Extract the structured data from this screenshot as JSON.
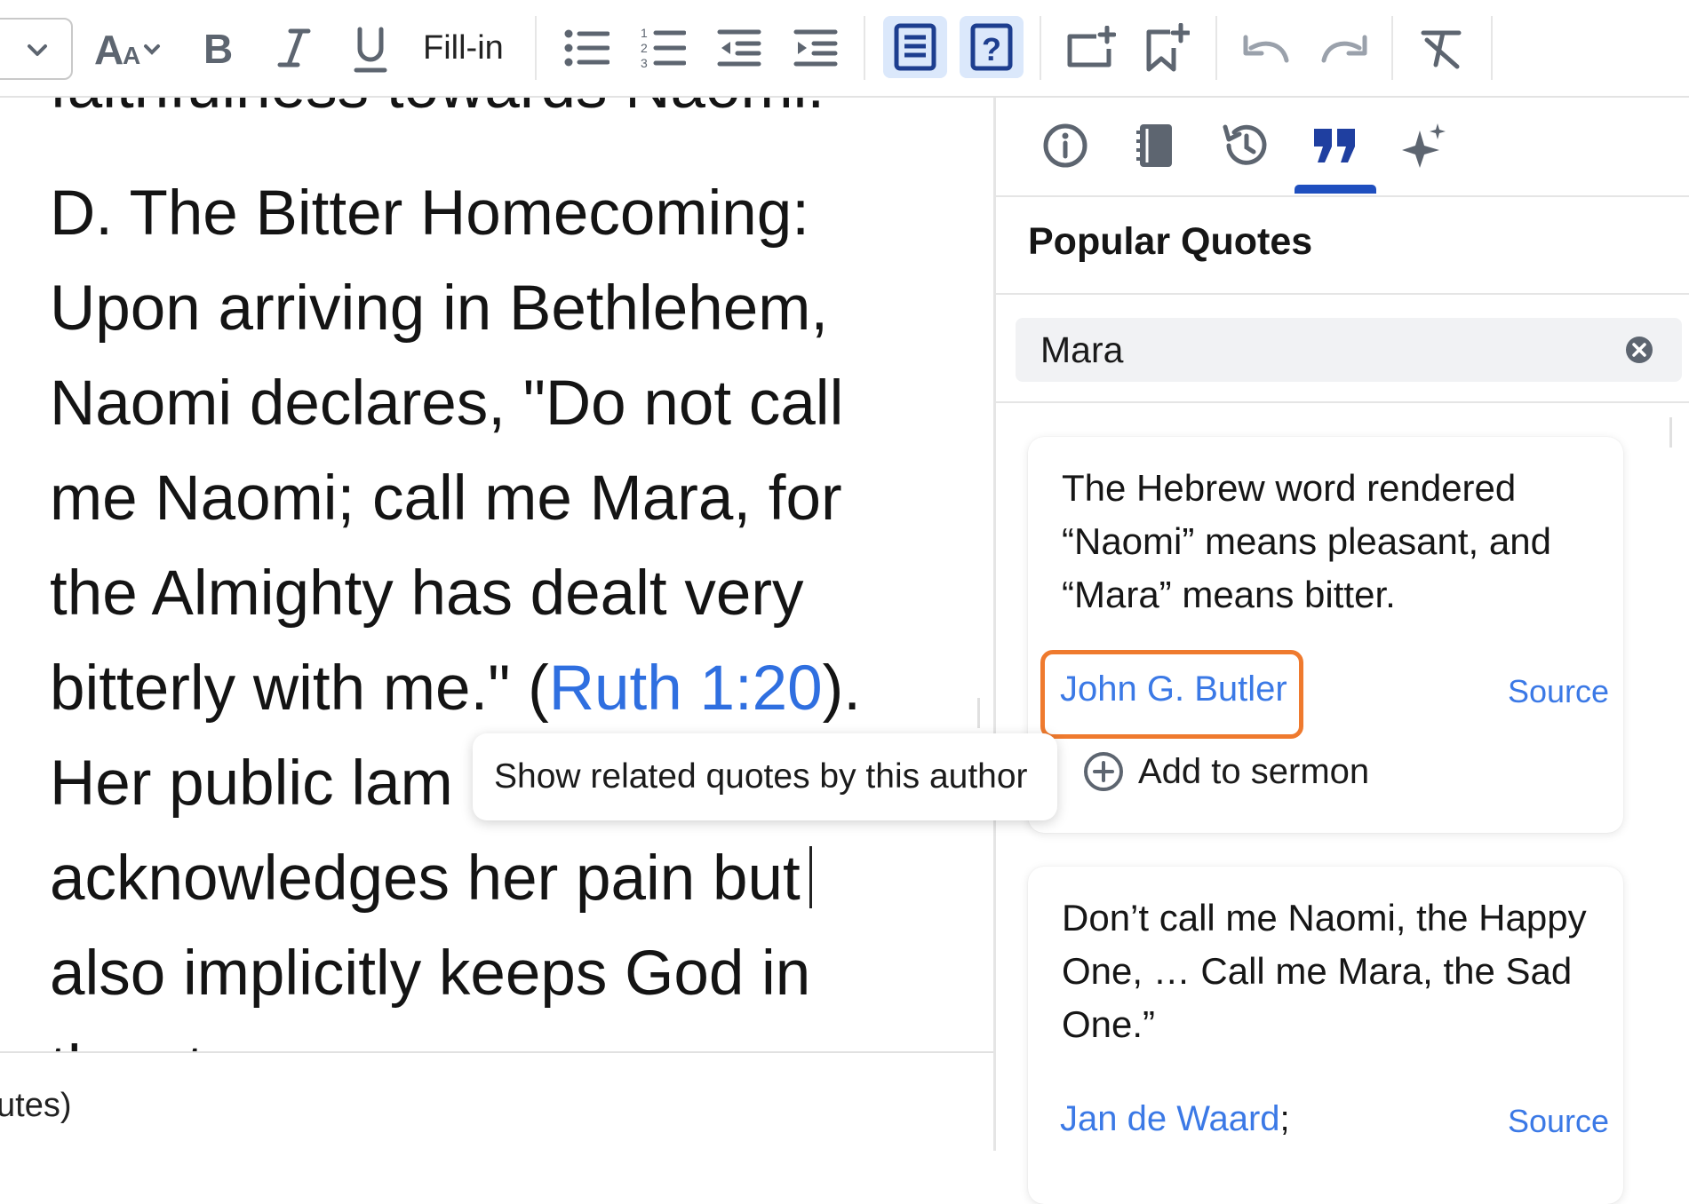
{
  "toolbar": {
    "fill_in_label": "Fill-in",
    "icons": [
      "chevron-down-icon",
      "font-size-icon",
      "bold-icon",
      "italic-icon",
      "underline-icon",
      "bullet-list-icon",
      "numbered-list-icon",
      "outdent-icon",
      "indent-icon",
      "text-block-icon",
      "question-box-icon",
      "add-slide-icon",
      "add-bookmark-icon",
      "undo-icon",
      "redo-icon",
      "clear-format-icon"
    ]
  },
  "editor": {
    "partial_top_line": "faithfulness towards Naomi.",
    "heading": "D. The Bitter Homecoming:",
    "body_lines": [
      "Upon arriving in Bethlehem,",
      "Naomi declares, \"Do not call",
      "me Naomi; call me Mara, for",
      "the Almighty has dealt very"
    ],
    "line_before_ref": "bitterly with me.\" (",
    "scripture_ref": "Ruth 1:20",
    "line_after_ref": ").",
    "line_under_tooltip": "Her public lam",
    "caret_line": "acknowledges her pain but",
    "last_line": "also implicitly keeps God in",
    "partial_bottom_line": "the story.",
    "bottom_bar_text": "utes)"
  },
  "panel": {
    "tabs": [
      "info-icon",
      "notebook-icon",
      "history-icon",
      "quote-icon",
      "sparkle-icon"
    ],
    "active_tab": "quote-icon",
    "title": "Popular Quotes",
    "search_value": "Mara",
    "accent_color": "#1f4fbf",
    "highlight_color": "#ef7a2e",
    "cards": [
      {
        "quote": "The Hebrew word rendered “Naomi” means pleasant, and “Mara” means bitter.",
        "author": "John G. Butler",
        "source_label": "Source",
        "add_label": "Add to sermon"
      },
      {
        "quote": "Don’t call me Naomi, the Happy One, … Call me Mara, the Sad One.”",
        "author": "Jan de Waard",
        "author_suffix": ";",
        "source_label": "Source"
      }
    ]
  },
  "tooltip": {
    "text": "Show related quotes by this author"
  }
}
